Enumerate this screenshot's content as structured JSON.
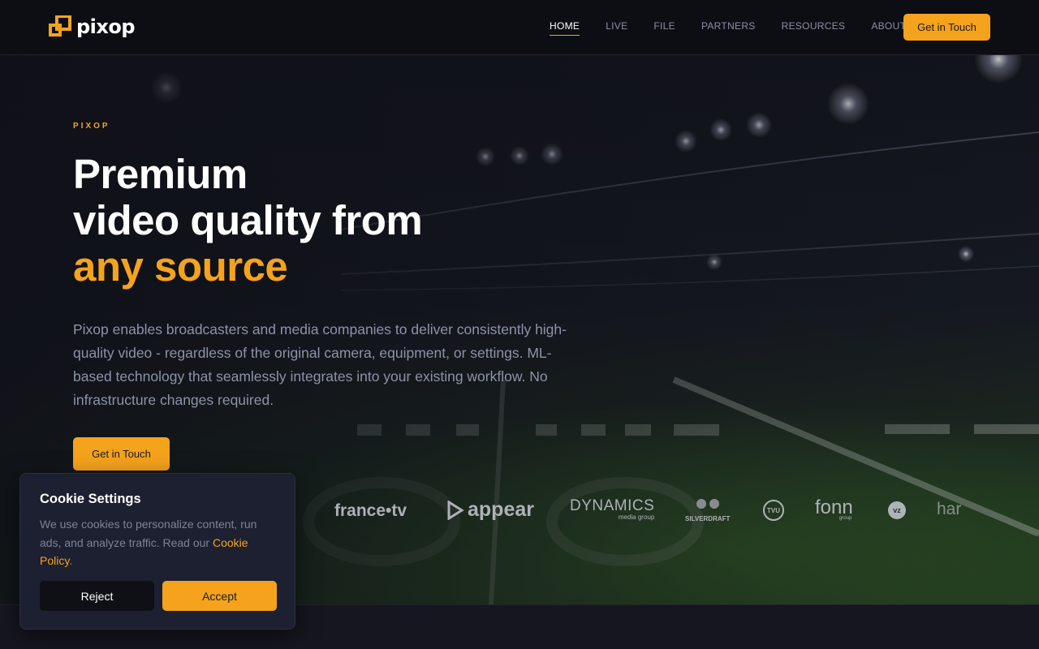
{
  "header": {
    "logo_text": "pixop",
    "nav": [
      {
        "label": "HOME",
        "active": true
      },
      {
        "label": "LIVE",
        "active": false
      },
      {
        "label": "FILE",
        "active": false
      },
      {
        "label": "PARTNERS",
        "active": false
      },
      {
        "label": "RESOURCES",
        "active": false
      },
      {
        "label": "ABOUT",
        "active": false
      }
    ],
    "cta_label": "Get in Touch"
  },
  "hero": {
    "eyebrow": "PIXOP",
    "headline_line1": "Premium",
    "headline_line2": "video quality from",
    "headline_accent": "any source",
    "description": "Pixop enables broadcasters and media companies to deliver consistently high-quality video - regardless of the original camera, equipment, or settings. ML-based technology that seamlessly integrates into your existing workflow. No infrastructure changes required.",
    "cta_label": "Get in Touch",
    "background": "stadium-image",
    "partner_logos": [
      {
        "name": "france-tv-logo",
        "text": "france•tv"
      },
      {
        "name": "appear-logo",
        "text": "appear"
      },
      {
        "name": "dynamics-media-group-logo",
        "text": "DYNAMICS",
        "sub": "media group"
      },
      {
        "name": "silverdraft-logo",
        "text": "SILVERDRAFT"
      },
      {
        "name": "tvu-logo",
        "text": "TVU"
      },
      {
        "name": "fonn-group-logo",
        "text": "fonn",
        "sub": "group"
      },
      {
        "name": "vz-logo",
        "text": "vz"
      },
      {
        "name": "harmonic-logo",
        "text": "har"
      }
    ]
  },
  "cookie": {
    "title": "Cookie Settings",
    "text": "We use cookies to personalize content, run ads, and analyze traffic. Read our ",
    "link_text": "Cookie Policy",
    "text_end": ".",
    "reject_label": "Reject",
    "accept_label": "Accept"
  },
  "colors": {
    "accent": "#f5a31c",
    "background": "#15161f",
    "header": "#0d0e13",
    "dialog": "#1d2030"
  }
}
